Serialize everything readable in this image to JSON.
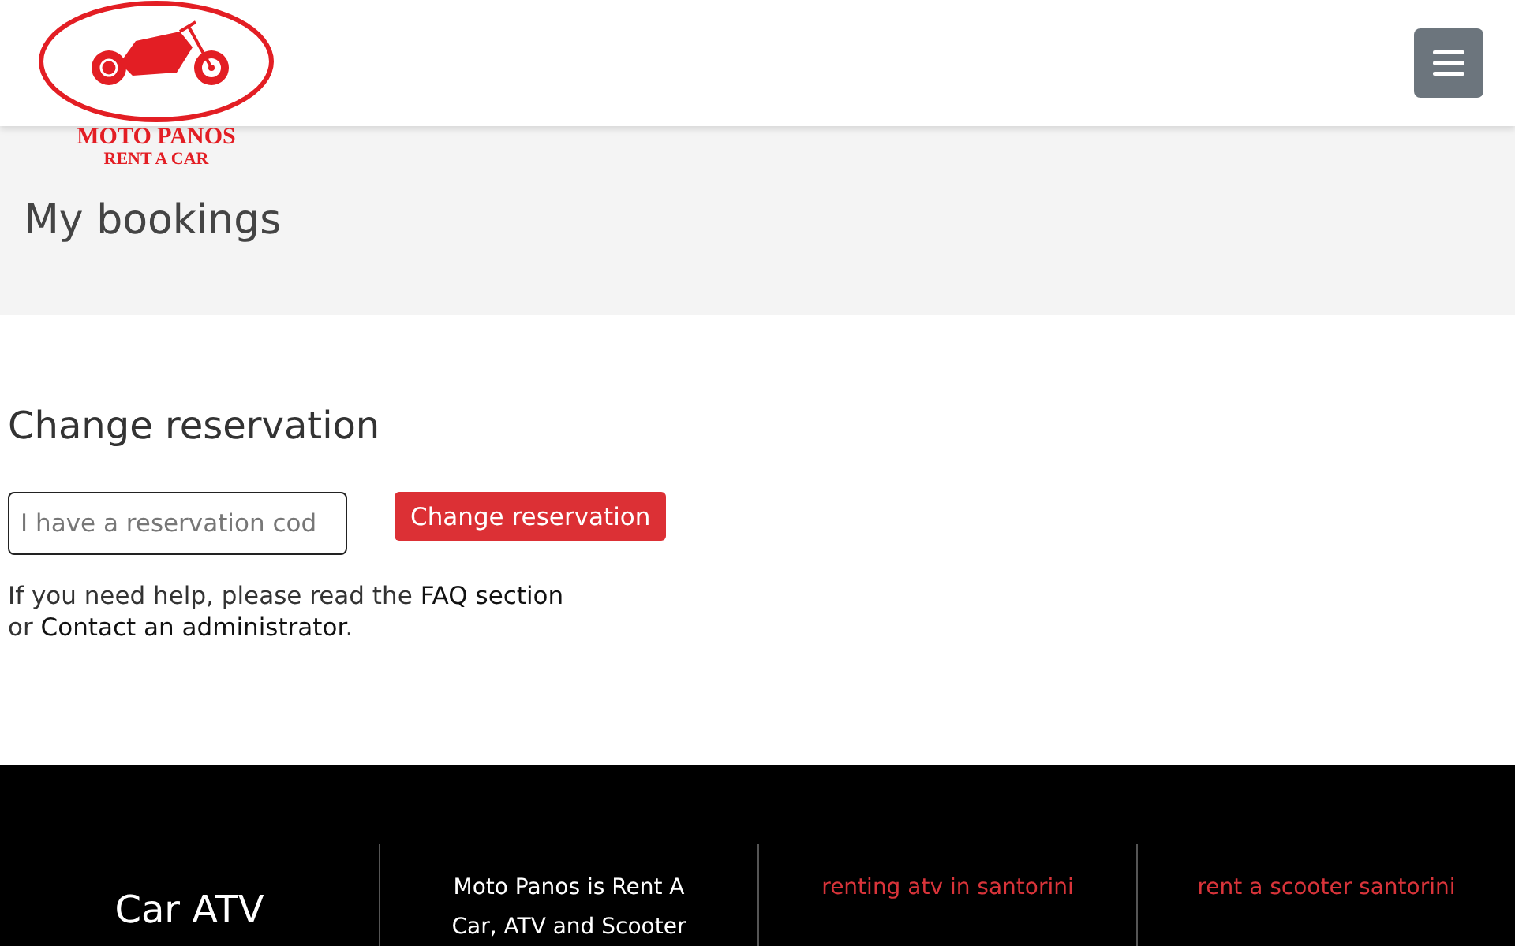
{
  "logo": {
    "title": "MOTO PANOS",
    "subtitle": "RENT A CAR"
  },
  "page_title": "My bookings",
  "reservation": {
    "heading": "Change reservation",
    "placeholder": "I have a reservation cod",
    "button": "Change reservation",
    "help_before": "If you need help, please read the ",
    "faq_link": "FAQ section",
    "help_or": "or ",
    "contact_link": "Contact an administrator",
    "help_end": "."
  },
  "footer": {
    "columns": [
      {
        "kind": "title",
        "text": "Car ATV"
      },
      {
        "kind": "text",
        "text": "Moto Panos is Rent A Car, ATV and Scooter"
      },
      {
        "kind": "link",
        "text": "renting atv in santorini"
      },
      {
        "kind": "link",
        "text": "rent a scooter santorini"
      }
    ]
  }
}
